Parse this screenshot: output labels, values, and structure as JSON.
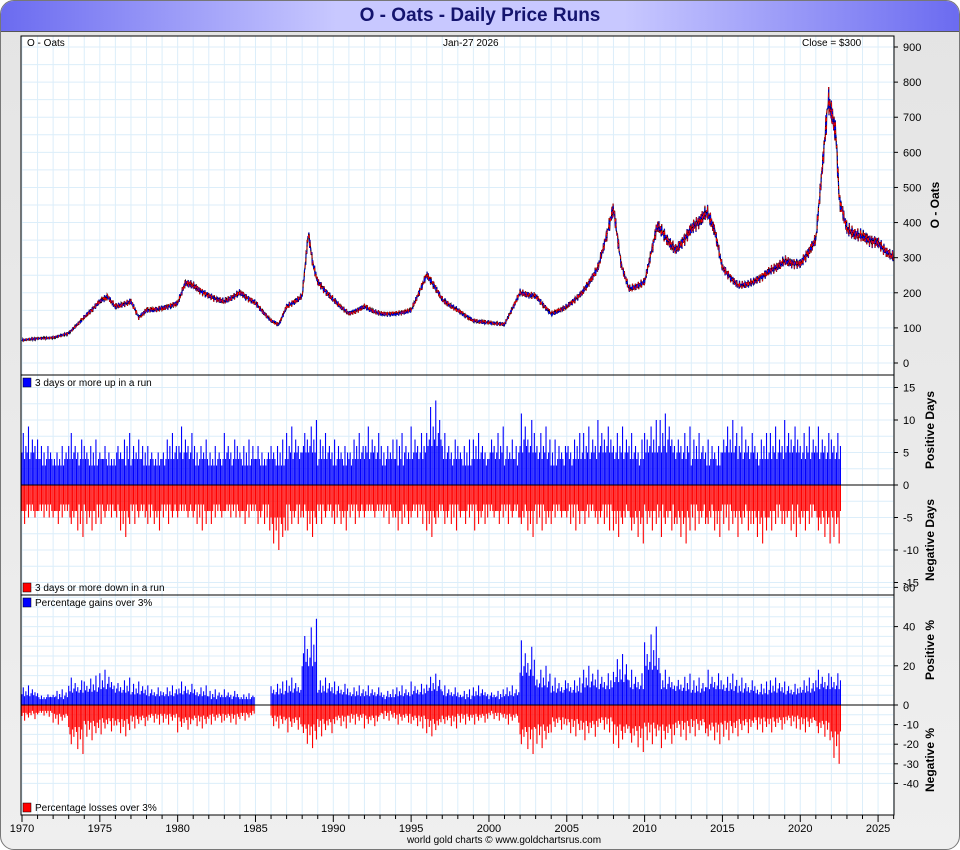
{
  "title": "O  -  Oats - Daily Price Runs",
  "header": {
    "symbol": "O  -  Oats",
    "date": "Jan-27  2026",
    "close": "Close = $300"
  },
  "footer": "world gold charts © www.goldchartsrus.com",
  "colors": {
    "up": "#0000ff",
    "down": "#ff0000",
    "price": "#000000",
    "grid": "#dceefa"
  },
  "chart_data": [
    {
      "type": "line",
      "name": "price",
      "ylabel": "O  -  Oats",
      "ylim": [
        0,
        900
      ],
      "yticks": [
        "0",
        "100",
        "200",
        "300",
        "400",
        "500",
        "600",
        "700",
        "800",
        "900"
      ],
      "xlim": [
        1970,
        2026
      ],
      "points": [
        [
          1970,
          65
        ],
        [
          1971,
          70
        ],
        [
          1972,
          72
        ],
        [
          1973,
          85
        ],
        [
          1974,
          130
        ],
        [
          1975,
          175
        ],
        [
          1975.5,
          190
        ],
        [
          1976,
          160
        ],
        [
          1977,
          175
        ],
        [
          1977.5,
          130
        ],
        [
          1978,
          150
        ],
        [
          1979,
          155
        ],
        [
          1980,
          170
        ],
        [
          1980.5,
          230
        ],
        [
          1981,
          220
        ],
        [
          1982,
          190
        ],
        [
          1983,
          175
        ],
        [
          1984,
          200
        ],
        [
          1985,
          170
        ],
        [
          1986,
          120
        ],
        [
          1986.5,
          110
        ],
        [
          1987,
          160
        ],
        [
          1988,
          190
        ],
        [
          1988.4,
          370
        ],
        [
          1988.7,
          280
        ],
        [
          1989,
          230
        ],
        [
          1990,
          180
        ],
        [
          1991,
          140
        ],
        [
          1992,
          160
        ],
        [
          1993,
          140
        ],
        [
          1994,
          140
        ],
        [
          1995,
          150
        ],
        [
          1996,
          250
        ],
        [
          1996.5,
          220
        ],
        [
          1997,
          180
        ],
        [
          1998,
          150
        ],
        [
          1999,
          120
        ],
        [
          2000,
          115
        ],
        [
          2001,
          110
        ],
        [
          2002,
          200
        ],
        [
          2003,
          190
        ],
        [
          2004,
          140
        ],
        [
          2005,
          160
        ],
        [
          2006,
          200
        ],
        [
          2007,
          270
        ],
        [
          2008,
          440
        ],
        [
          2008.5,
          280
        ],
        [
          2009,
          210
        ],
        [
          2010,
          230
        ],
        [
          2010.8,
          390
        ],
        [
          2011,
          380
        ],
        [
          2012,
          320
        ],
        [
          2013,
          380
        ],
        [
          2014,
          430
        ],
        [
          2014.5,
          380
        ],
        [
          2015,
          270
        ],
        [
          2016,
          220
        ],
        [
          2017,
          230
        ],
        [
          2018,
          260
        ],
        [
          2019,
          290
        ],
        [
          2020,
          280
        ],
        [
          2021,
          350
        ],
        [
          2021.8,
          750
        ],
        [
          2022.3,
          650
        ],
        [
          2022.5,
          470
        ],
        [
          2023,
          380
        ],
        [
          2024,
          360
        ],
        [
          2025,
          340
        ],
        [
          2026,
          300
        ]
      ]
    },
    {
      "type": "bar",
      "name": "runs",
      "legend_up": "3 days or more up in a run",
      "legend_down": "3 days or more down in a run",
      "ylabel_up": "Positive Days",
      "ylabel_down": "Negative Days",
      "ylim": [
        -17,
        17
      ],
      "yticks": [
        "-15",
        "-10",
        "-5",
        "0",
        "5",
        "10",
        "15"
      ],
      "years_start": 1970,
      "up_peak_by_year": [
        9,
        7,
        6,
        8,
        7,
        6,
        8,
        7,
        6,
        8,
        9,
        7,
        6,
        8,
        7,
        6,
        7,
        9,
        10,
        8,
        7,
        8,
        9,
        7,
        8,
        9,
        13,
        8,
        7,
        8,
        9,
        7,
        11,
        9,
        7,
        8,
        9,
        10,
        9,
        8,
        10,
        11,
        9,
        8,
        7,
        10,
        9,
        8,
        9,
        10,
        9,
        9,
        9
      ],
      "down_peak_by_year": [
        -6,
        -5,
        -6,
        -8,
        -7,
        -6,
        -8,
        -6,
        -7,
        -6,
        -5,
        -7,
        -6,
        -5,
        -6,
        -7,
        -10,
        -7,
        -8,
        -6,
        -7,
        -6,
        -5,
        -6,
        -7,
        -6,
        -8,
        -7,
        -6,
        -7,
        -6,
        -6,
        -8,
        -7,
        -6,
        -7,
        -6,
        -7,
        -8,
        -9,
        -7,
        -8,
        -9,
        -7,
        -8,
        -7,
        -8,
        -9,
        -7,
        -8,
        -7,
        -9,
        -9
      ]
    },
    {
      "type": "bar",
      "name": "percent",
      "legend_up": "Percentage gains over 3%",
      "legend_down": "Percentage losses over 3%",
      "ylabel_up": "Positive %",
      "ylabel_down": "Negative %",
      "ylim": [
        -45,
        65
      ],
      "yticks": [
        "-40",
        "-30",
        "-20",
        "-10",
        "0",
        "20",
        "40",
        "60"
      ],
      "years_start": 1970,
      "up_peak_by_year": [
        10,
        6,
        8,
        14,
        15,
        18,
        14,
        12,
        10,
        10,
        12,
        10,
        8,
        8,
        6,
        0,
        12,
        14,
        44,
        14,
        12,
        10,
        10,
        8,
        10,
        12,
        16,
        10,
        8,
        10,
        8,
        10,
        33,
        20,
        14,
        14,
        20,
        18,
        26,
        18,
        40,
        18,
        16,
        14,
        18,
        16,
        14,
        12,
        14,
        12,
        14,
        18,
        18
      ],
      "down_peak_by_year": [
        -8,
        -6,
        -10,
        -25,
        -18,
        -15,
        -16,
        -12,
        -10,
        -10,
        -14,
        -12,
        -10,
        -10,
        -8,
        0,
        -12,
        -14,
        -22,
        -16,
        -12,
        -10,
        -12,
        -8,
        -10,
        -12,
        -16,
        -12,
        -10,
        -10,
        -8,
        -10,
        -25,
        -22,
        -14,
        -16,
        -18,
        -14,
        -22,
        -24,
        -20,
        -22,
        -18,
        -16,
        -20,
        -18,
        -16,
        -14,
        -14,
        -12,
        -14,
        -18,
        -30
      ]
    }
  ],
  "xaxis": {
    "ticks": [
      "1970",
      "1975",
      "1980",
      "1985",
      "1990",
      "1995",
      "2000",
      "2005",
      "2010",
      "2015",
      "2020",
      "2025"
    ]
  }
}
